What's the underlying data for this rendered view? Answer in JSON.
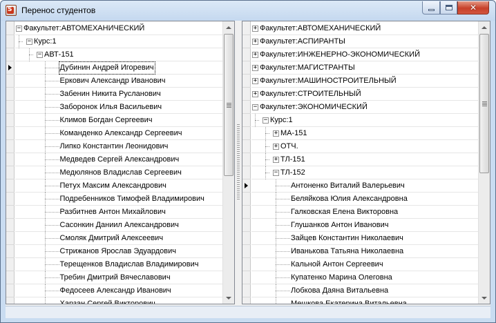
{
  "window": {
    "title": "Перенос студентов",
    "app_icon_letter": "S"
  },
  "left_tree": {
    "faculty": "Факультет:АВТОМЕХАНИЧЕСКИЙ",
    "course": "Курс:1",
    "group": "АВТ-151",
    "students": [
      "Дубинин Андрей Игоревич",
      "Еркович Александр Иванович",
      "Забенин Никита Русланович",
      "Заборонок Илья Васильевич",
      "Климов Богдан Сергеевич",
      "Команденко Александр Сергеевич",
      "Липко Константин Леонидович",
      "Медведев Сергей Александрович",
      "Медюлянов Владислав Сергеевич",
      "Петух Максим Александрович",
      "Подребенников Тимофей Владимирович",
      "Разбитнев Антон Михайлович",
      "Сасонкин Даниил Александрович",
      "Смоляк Дмитрий Алексеевич",
      "Стрижанов Ярослав Эдуардович",
      "Терещенков Владислав Владимирович",
      "Требин Дмитрий Вячеславович",
      "Федосеев Александр Иванович",
      "Харзан Сергей Викторович"
    ],
    "selected_student_index": 0
  },
  "right_tree": {
    "faculties": [
      "Факультет:АВТОМЕХАНИЧЕСКИЙ",
      "Факультет:АСПИРАНТЫ",
      "Факультет:ИНЖЕНЕРНО-ЭКОНОМИЧЕСКИЙ",
      "Факультет:МАГИСТРАНТЫ",
      "Факультет:МАШИНОСТРОИТЕЛЬНЫЙ",
      "Факультет:СТРОИТЕЛЬНЫЙ",
      "Факультет:ЭКОНОМИЧЕСКИЙ"
    ],
    "course": "Курс:1",
    "groups": [
      "МА-151",
      "ОТЧ.",
      "ТЛ-151",
      "ТЛ-152"
    ],
    "students": [
      "Антоненко Виталий Валерьевич",
      "Беляйкова Юлия Александровна",
      "Галковская Елена Викторовна",
      "Глушанков Антон Иванович",
      "Зайцев Константин Николаевич",
      "Иванькова Татьяна Николаевна",
      "Кальной Антон Сергеевич",
      "Купатенко Марина Олеговна",
      "Лобкова Даяна Витальевна",
      "Мешкова Екатерина Витальевна"
    ]
  },
  "icons": {
    "expand": "+",
    "collapse": "−",
    "row_pointer": "row-pointer-icon"
  }
}
